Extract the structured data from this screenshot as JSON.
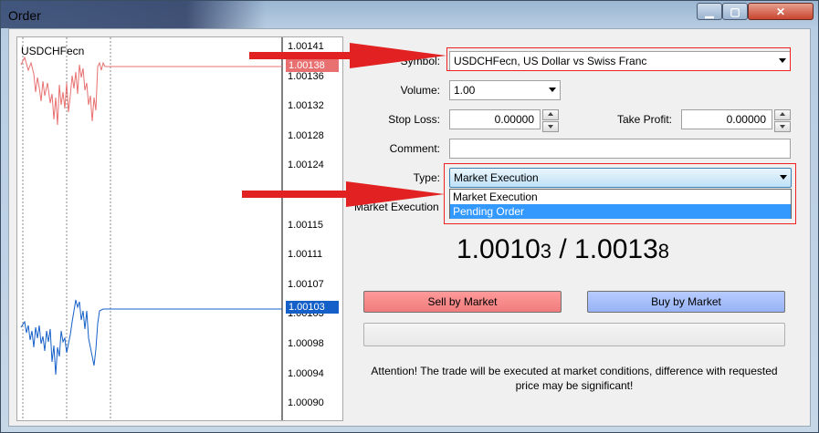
{
  "window": {
    "title": "Order",
    "controls": {
      "minimize": "▁",
      "maximize": "▢",
      "close": "✕"
    }
  },
  "chart": {
    "symbol": "USDCHFecn",
    "price_ticks": [
      "1.00141",
      "1.00136",
      "1.00132",
      "1.00128",
      "1.00124",
      "1.00120",
      "1.00115",
      "1.00111",
      "1.00107",
      "1.00103",
      "1.00098",
      "1.00094",
      "1.00090"
    ],
    "ask_tag": "1.00138",
    "bid_tag": "1.00103",
    "ask_color": "#e87070",
    "bid_color": "#1560c8"
  },
  "form": {
    "symbol_label": "Symbol:",
    "symbol_value": "USDCHFecn, US Dollar vs Swiss Franc",
    "volume_label": "Volume:",
    "volume_value": "1.00",
    "stop_loss_label": "Stop Loss:",
    "stop_loss_value": "0.00000",
    "take_profit_label": "Take Profit:",
    "take_profit_value": "0.00000",
    "comment_label": "Comment:",
    "comment_value": "",
    "type_label": "Type:",
    "type_value": "Market Execution",
    "type_options": [
      "Market Execution",
      "Pending Order"
    ],
    "behind_text": "Market Execution"
  },
  "quote": {
    "bid_main": "1.0010",
    "bid_small": "3",
    "sep": " / ",
    "ask_main": "1.0013",
    "ask_small": "8"
  },
  "buttons": {
    "sell": "Sell by Market",
    "buy": "Buy by Market"
  },
  "notice": "Attention! The trade will be executed at market conditions, difference with requested price may be significant!",
  "colors": {
    "annotation_red": "#e22222",
    "sell_bg": "#f58a8a",
    "buy_bg": "#a8c0fa"
  }
}
